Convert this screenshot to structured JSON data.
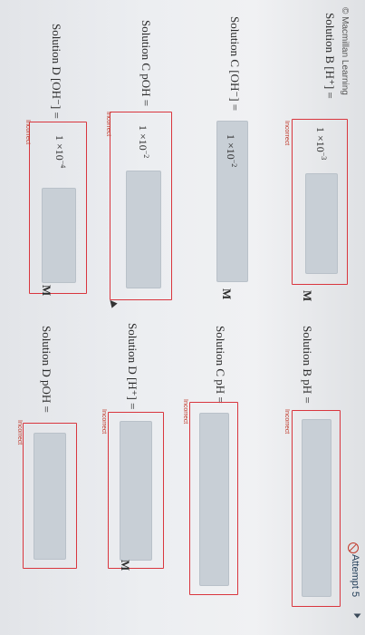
{
  "header": {
    "credit": "© Macmillan Learning",
    "attempt": "Attempt 5"
  },
  "feedback": "Incorrect",
  "unit": "M",
  "rows": {
    "b_h": {
      "label": "Solution B [H⁺] =",
      "mantissa": "1 ×10",
      "exponent": "−3"
    },
    "b_ph": {
      "label": "Solution B pH ="
    },
    "c_oh": {
      "label": "Solution C [OH⁻] =",
      "mantissa": "1 ×10",
      "exponent": "−2"
    },
    "c_ph": {
      "label": "Solution C pH ="
    },
    "c_poh": {
      "label": "Solution C pOH =",
      "mantissa": "1 ×10",
      "exponent": "−2"
    },
    "d_h": {
      "label": "Solution D [H⁺] ="
    },
    "d_oh": {
      "label": "Solution D [OH⁻] =",
      "mantissa": "1 ×10",
      "exponent": "−4"
    },
    "d_poh": {
      "label": "Solution D pOH ="
    }
  }
}
